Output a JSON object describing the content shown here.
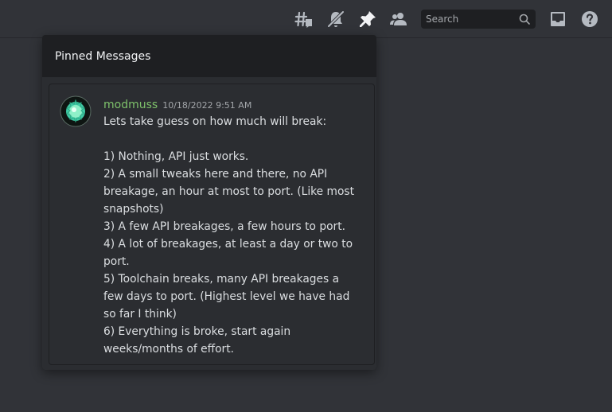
{
  "topbar": {
    "icons": [
      "threads-icon",
      "bell-muted-icon",
      "pin-icon",
      "members-icon",
      "inbox-icon",
      "help-icon"
    ],
    "search_placeholder": "Search"
  },
  "pinned_popout": {
    "title": "Pinned Messages",
    "message": {
      "author": "modmuss",
      "author_color": "#7ec26b",
      "timestamp": "10/18/2022 9:51 AM",
      "content": "Lets take guess on how much will break:\n\n1) Nothing, API just works.\n2) A small tweaks here and there, no API breakage, an hour at most to port. (Like most snapshots)\n3) A few API breakages, a few hours to port.\n4) A lot of breakages, at least a day or two to port.\n5) Toolchain breaks, many API breakages a few days to port. (Highest level we have had so far I think)\n6) Everything is broke, start again weeks/months of effort."
    }
  },
  "colors": {
    "background": "#313338",
    "popout_header": "#1e1f22",
    "popout_body": "#2b2d31",
    "text": "#dbdee1",
    "muted": "#a3a6aa"
  }
}
